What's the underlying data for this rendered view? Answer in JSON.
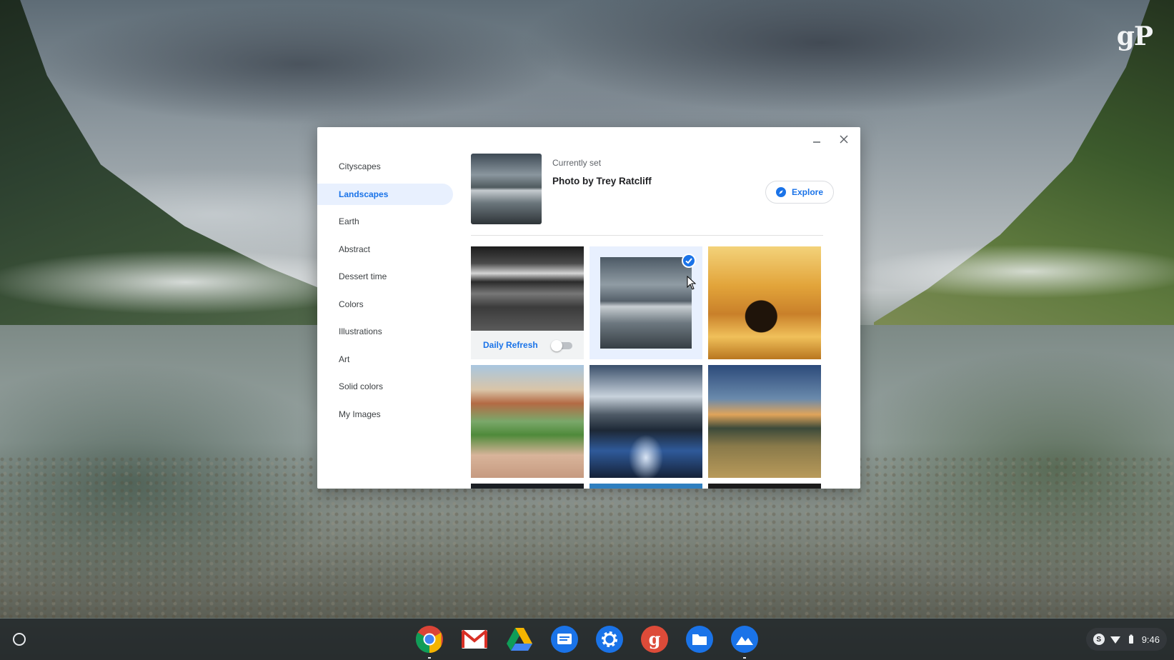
{
  "watermark": "gP",
  "window": {
    "minimize_label": "–",
    "close_label": "×"
  },
  "sidebar": {
    "items": [
      {
        "label": "Cityscapes",
        "active": false
      },
      {
        "label": "Landscapes",
        "active": true
      },
      {
        "label": "Earth",
        "active": false
      },
      {
        "label": "Abstract",
        "active": false
      },
      {
        "label": "Dessert time",
        "active": false
      },
      {
        "label": "Colors",
        "active": false
      },
      {
        "label": "Illustrations",
        "active": false
      },
      {
        "label": "Art",
        "active": false
      },
      {
        "label": "Solid colors",
        "active": false
      },
      {
        "label": "My Images",
        "active": false
      }
    ]
  },
  "current": {
    "label": "Currently set",
    "credit": "Photo by Trey Ratcliff",
    "explore_label": "Explore"
  },
  "grid": {
    "daily_refresh_label": "Daily Refresh",
    "daily_refresh_on": false,
    "selected_index": 1
  },
  "shelf": {
    "apps": [
      "chrome-icon",
      "gmail-icon",
      "drive-icon",
      "messages-icon",
      "settings-icon",
      "google-plus-icon",
      "files-icon",
      "wallpaper-icon"
    ],
    "tray": {
      "badge": "S",
      "time": "9:46"
    }
  },
  "colors": {
    "accent": "#1a73e8",
    "selected_bg": "#e8f0fe"
  }
}
